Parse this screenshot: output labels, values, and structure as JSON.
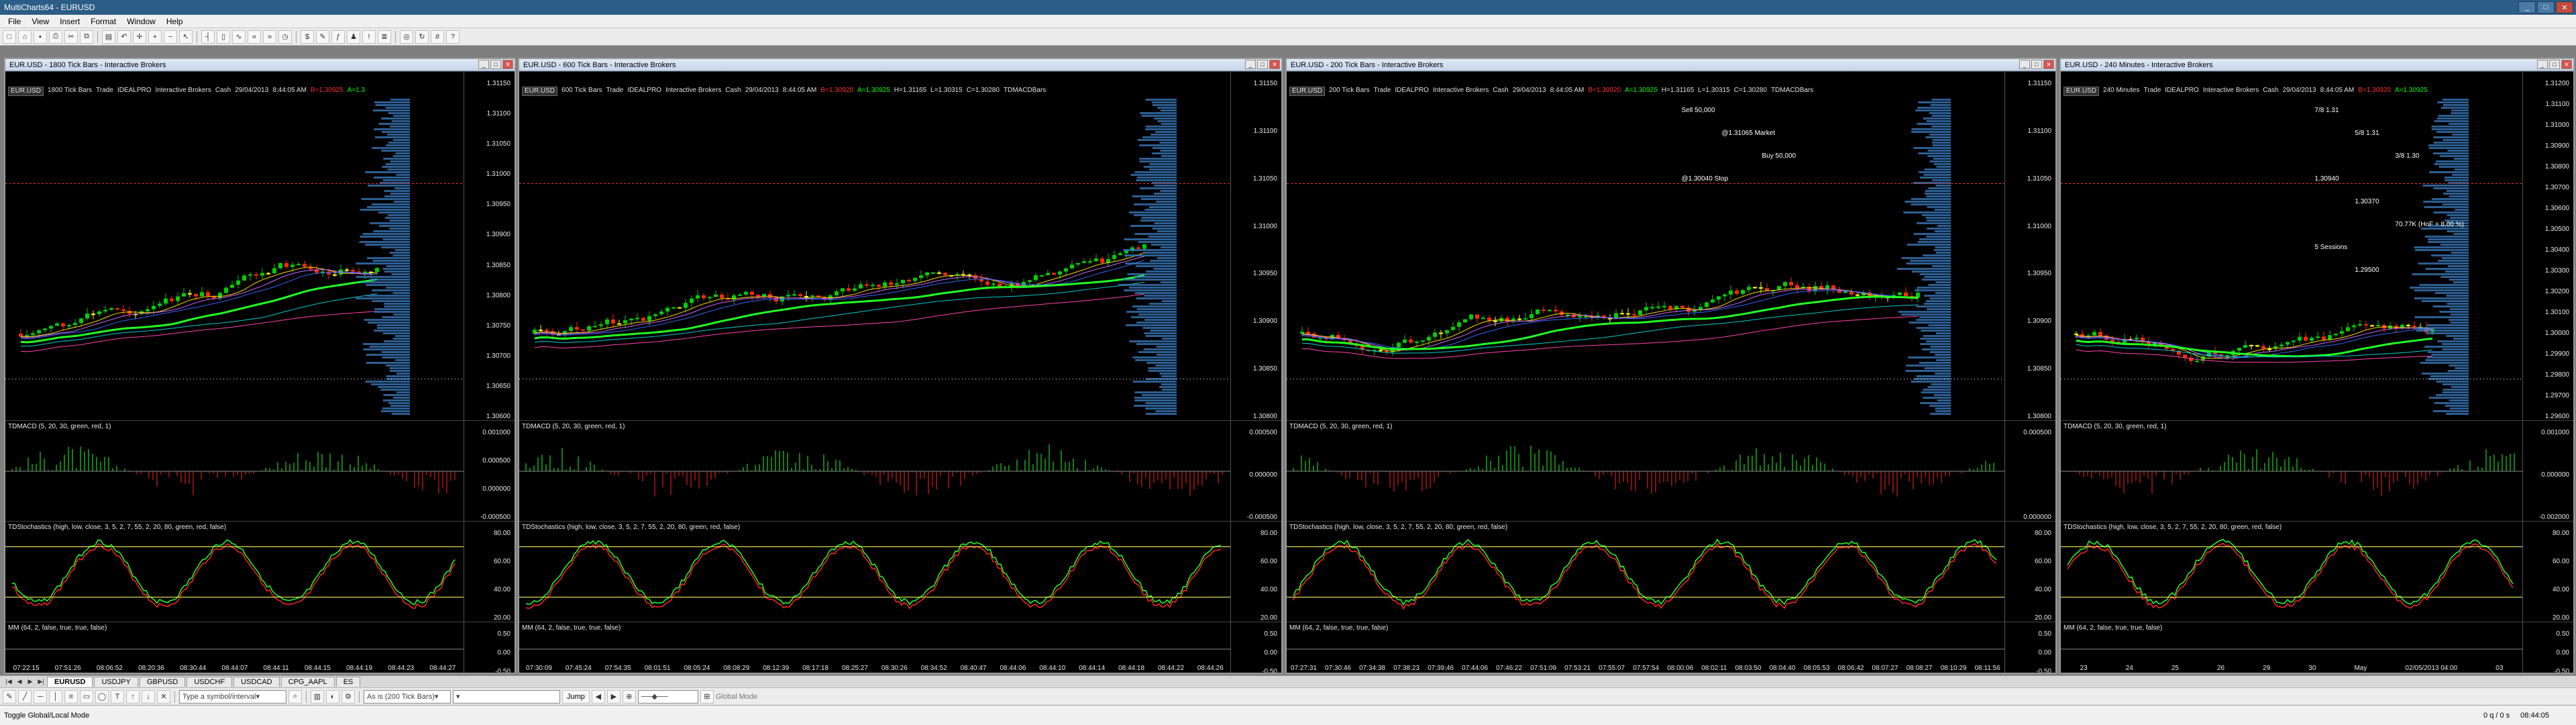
{
  "app": {
    "title": "MultiCharts64 - EURUSD"
  },
  "menu": [
    "File",
    "View",
    "Insert",
    "Format",
    "Window",
    "Help"
  ],
  "toolbar_icons": [
    "new-icon",
    "open-icon",
    "save-icon",
    "print-icon",
    "cut-icon",
    "copy-icon",
    "paste-icon",
    "undo-icon",
    "crosshair-icon",
    "zoom-in-icon",
    "zoom-out-icon",
    "cursor-icon",
    "bar-chart-icon",
    "candle-chart-icon",
    "line-chart-icon",
    "scroll-left-icon",
    "scroll-right-icon",
    "time-icon",
    "price-icon",
    "format-icon",
    "indicator-icon",
    "strategy-icon",
    "alert-icon",
    "dom-icon",
    "order-icon",
    "refresh-icon",
    "grid-icon",
    "help-icon"
  ],
  "panes": [
    {
      "title": "EUR.USD - 1800 Tick Bars - Interactive Brokers",
      "status": {
        "sym": "EUR.USD",
        "interval": "1800 Tick Bars",
        "trade": "Trade",
        "acct": "IDEALPRO",
        "broker": "Interactive Brokers",
        "cash": "Cash",
        "date": "29/04/2013",
        "time": "8:44:05 AM",
        "bid": "B=1.30925",
        "ask": "A=1.3"
      },
      "price_ticks": [
        "1.31150",
        "1.31100",
        "1.31050",
        "1.31000",
        "1.30950",
        "1.30900",
        "1.30850",
        "1.30800",
        "1.30750",
        "1.30700",
        "1.30650",
        "1.30600"
      ],
      "macd_label": "TDMACD (5, 20, 30, green, red, 1)",
      "macd_ticks": [
        "0.001000",
        "0.000500",
        "0.000000",
        "-0.000500"
      ],
      "stoch_label": "TDStochastics (high, low, close, 3, 5, 2, 7, 55, 2, 20, 80, green, red, false)",
      "stoch_ticks": [
        "80.00",
        "60.00",
        "40.00",
        "20.00"
      ],
      "mm_label": "MM (64, 2, false, true, true, false)",
      "mm_ticks": [
        "0.50",
        "0.00",
        "-0.50"
      ],
      "time_labels": [
        "07:22:15",
        "07:51:26",
        "08:06:52",
        "08:20:36",
        "08:30:44",
        "08:44:07",
        "08:44:11",
        "08:44:15",
        "08:44:19",
        "08:44:23",
        "08:44:27"
      ]
    },
    {
      "title": "EUR.USD - 600 Tick Bars - Interactive Brokers",
      "status": {
        "sym": "EUR.USD",
        "interval": "600 Tick Bars",
        "trade": "Trade",
        "acct": "IDEALPRO",
        "broker": "Interactive Brokers",
        "cash": "Cash",
        "date": "29/04/2013",
        "time": "8:44:05 AM",
        "bid": "B=1.30920",
        "ask": "A=1.30925",
        "high": "H=1.31165",
        "low": "L=1.30315",
        "close": "C=1.30280",
        "bars": "TDMACDBars"
      },
      "price_ticks": [
        "1.31150",
        "1.31100",
        "1.31050",
        "1.31000",
        "1.30950",
        "1.30900",
        "1.30850",
        "1.30800"
      ],
      "macd_label": "TDMACD (5, 20, 30, green, red, 1)",
      "macd_ticks": [
        "0.000500",
        "0.000000",
        "-0.000500"
      ],
      "stoch_label": "TDStochastics (high, low, close, 3, 5, 2, 7, 55, 2, 20, 80, green, red, false)",
      "stoch_ticks": [
        "80.00",
        "60.00",
        "40.00",
        "20.00"
      ],
      "mm_label": "MM (64, 2, false, true, true, false)",
      "mm_ticks": [
        "0.50",
        "0.00",
        "-0.50"
      ],
      "time_labels": [
        "07:30:09",
        "07:45:24",
        "07:54:35",
        "08:01:51",
        "08:05:24",
        "08:08:29",
        "08:12:39",
        "08:17:18",
        "08:25:27",
        "08:30:26",
        "08:34:52",
        "08:40:47",
        "08:44:06",
        "08:44:10",
        "08:44:14",
        "08:44:18",
        "08:44:22",
        "08:44:26"
      ]
    },
    {
      "title": "EUR.USD - 200 Tick Bars - Interactive Brokers",
      "status": {
        "sym": "EUR.USD",
        "interval": "200 Tick Bars",
        "trade": "Trade",
        "acct": "IDEALPRO",
        "broker": "Interactive Brokers",
        "cash": "Cash",
        "date": "29/04/2013",
        "time": "8:44:05 AM",
        "bid": "B=1.30920",
        "ask": "A=1.30925",
        "high": "H=1.31165",
        "low": "L=1.30315",
        "close": "C=1.30280",
        "bars": "TDMACDBars"
      },
      "price_ticks": [
        "1.31150",
        "1.31100",
        "1.31050",
        "1.31000",
        "1.30950",
        "1.30900",
        "1.30850",
        "1.30800"
      ],
      "annotations": {
        "sell": "Sell 50,000",
        "sell_detail": "@1.31065 Market",
        "buy": "Buy 50,000",
        "buy_detail": "@1.30040 Stop"
      },
      "macd_label": "TDMACD (5, 20, 30, green, red, 1)",
      "macd_ticks": [
        "0.000500",
        "0.000000"
      ],
      "stoch_label": "TDStochastics (high, low, close, 3, 5, 2, 7, 55, 2, 20, 80, green, red, false)",
      "stoch_ticks": [
        "80.00",
        "60.00",
        "40.00",
        "20.00"
      ],
      "mm_label": "MM (64, 2, false, true, true, false)",
      "mm_ticks": [
        "0.50",
        "0.00",
        "-0.50"
      ],
      "time_labels": [
        "07:27:31",
        "07:30:46",
        "07:34:38",
        "07:38:23",
        "07:39:46",
        "07:44:06",
        "07:46:22",
        "07:51:09",
        "07:53:21",
        "07:55:07",
        "07:57:54",
        "08:00:06",
        "08:02:11",
        "08:03:50",
        "08:04:40",
        "08:05:53",
        "08:06:42",
        "08:07:27",
        "08:08:27",
        "08:10:29",
        "08:11:56"
      ]
    },
    {
      "title": "EUR.USD - 240 Minutes - Interactive Brokers",
      "status": {
        "sym": "EUR.USD",
        "interval": "240 Minutes",
        "trade": "Trade",
        "acct": "IDEALPRO",
        "broker": "Interactive Brokers",
        "cash": "Cash",
        "date": "29/04/2013",
        "time": "8:44:05 AM",
        "bid": "B=1.30920",
        "ask": "A=1.30925"
      },
      "price_ticks": [
        "1.31200",
        "1.31100",
        "1.31000",
        "1.30900",
        "1.30800",
        "1.30700",
        "1.30600",
        "1.30500",
        "1.30400",
        "1.30300",
        "1.30200",
        "1.30100",
        "1.30000",
        "1.29900",
        "1.29800",
        "1.29700",
        "1.29600"
      ],
      "annotations": {
        "fib1": "7/8  1.31",
        "fib2": "5/8  1.31",
        "fib3": "3/8  1.30",
        "level1": "1.30940",
        "level2": "1.30370",
        "vol": "70.77K (HoF = 8.00 %)",
        "sessions": "5 Sessions",
        "low": "1.29500"
      },
      "macd_label": "TDMACD (5, 20, 30, green, red, 1)",
      "macd_ticks": [
        "0.001000",
        "0.000000",
        "-0.002000"
      ],
      "stoch_label": "TDStochastics (high, low, close, 3, 5, 2, 7, 55, 2, 20, 80, green, red, false)",
      "stoch_ticks": [
        "80.00",
        "60.00",
        "40.00",
        "20.00"
      ],
      "mm_label": "MM (64, 2, false, true, true, false)",
      "mm_ticks": [
        "0.50",
        "0.00",
        "-0.50"
      ],
      "time_labels": [
        "23",
        "24",
        "25",
        "26",
        "29",
        "30",
        "May",
        "02/05/2013 04:00",
        "03"
      ]
    }
  ],
  "tabs": [
    "EURUSD",
    "USDJPY",
    "GBPUSD",
    "USDCHF",
    "USDCAD",
    "CPG_AAPL",
    "ES"
  ],
  "drawbar": {
    "symbol_placeholder": "Type a symbol/interval",
    "interval_combo": "As is (200 Tick Bars)",
    "jump_label": "Jump",
    "global_mode": "Global Mode"
  },
  "statusbar": {
    "left": "Toggle Global/Local Mode",
    "right1": "0 q / 0 s",
    "right2": "08:44:05"
  },
  "colors": {
    "bull": "#00d000",
    "bear": "#ff2a00",
    "doji": "#ffff00",
    "ma_green": "#22ff22",
    "ma_red": "#ff2222"
  }
}
